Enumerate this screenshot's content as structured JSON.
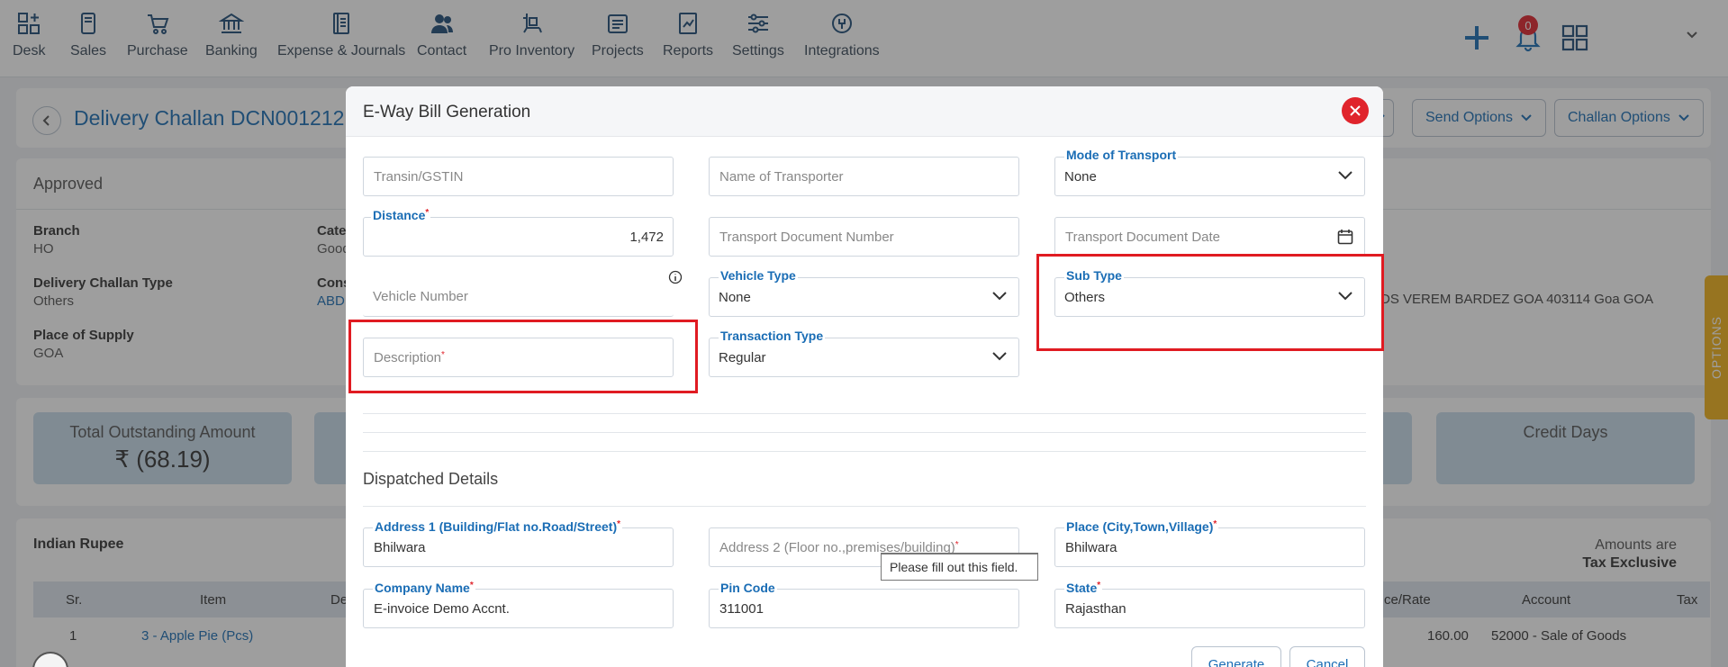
{
  "nav": {
    "items": [
      {
        "label": "Desk",
        "icon": "desk-icon"
      },
      {
        "label": "Sales",
        "icon": "sales-icon"
      },
      {
        "label": "Purchase",
        "icon": "cart-icon"
      },
      {
        "label": "Banking",
        "icon": "bank-icon"
      },
      {
        "label": "Expense & Journals",
        "icon": "journal-icon"
      },
      {
        "label": "Contact",
        "icon": "contact-icon"
      },
      {
        "label": "Pro Inventory",
        "icon": "inventory-icon"
      },
      {
        "label": "Projects",
        "icon": "projects-icon"
      },
      {
        "label": "Reports",
        "icon": "reports-icon"
      },
      {
        "label": "Settings",
        "icon": "settings-icon"
      },
      {
        "label": "Integrations",
        "icon": "integrations-icon"
      }
    ],
    "notification_count": "0"
  },
  "page": {
    "title": "Delivery Challan DCN001212",
    "send_options": "Send Options",
    "challan_options": "Challan Options",
    "status": "Approved",
    "fields": {
      "branch_label": "Branch",
      "branch_value": "HO",
      "category_label": "Cate",
      "category_value": "Good",
      "challan_type_label": "Delivery Challan Type",
      "challan_type_value": "Others",
      "consignee_label": "Cons",
      "consignee_value": "ABD",
      "place_label": "Place of Supply",
      "place_value": "GOA",
      "address_text": "DS VEREM BARDEZ GOA 403114 Goa GOA"
    },
    "options_tab": "OPTIONS",
    "summary": {
      "outstanding_title": "Total Outstanding Amount",
      "outstanding_value": "₹ (68.19)",
      "credit_days_title": "Credit Days"
    },
    "lines": {
      "currency": "Indian Rupee",
      "amounts_are": "Amounts are",
      "tax_mode": "Tax Exclusive",
      "headers": {
        "sr": "Sr.",
        "item": "Item",
        "desc": "De",
        "rate": "ce/Rate",
        "account": "Account",
        "tax": "Tax"
      },
      "row": {
        "sr": "1",
        "item": "3 - Apple Pie (Pcs)",
        "rate": "160.00",
        "account": "52000 - Sale of Goods"
      }
    }
  },
  "modal": {
    "title": "E-Way Bill Generation",
    "fields": {
      "transin_placeholder": "Transin/GSTIN",
      "transporter_placeholder": "Name of Transporter",
      "mode_label": "Mode of Transport",
      "mode_value": "None",
      "distance_label": "Distance",
      "distance_value": "1,472",
      "tdn_placeholder": "Transport Document Number",
      "tdd_placeholder": "Transport Document Date",
      "vehicle_number_placeholder": "Vehicle Number",
      "vehicle_type_label": "Vehicle Type",
      "vehicle_type_value": "None",
      "sub_type_label": "Sub Type",
      "sub_type_value": "Others",
      "description_placeholder": "Description",
      "transaction_type_label": "Transaction Type",
      "transaction_type_value": "Regular"
    },
    "dispatched": {
      "title": "Dispatched Details",
      "address1_label": "Address 1 (Building/Flat no.Road/Street)",
      "address1_value": "Bhilwara",
      "address2_placeholder": "Address 2 (Floor no.,premises/building)",
      "place_label": "Place (City,Town,Village)",
      "place_value": "Bhilwara",
      "company_label": "Company Name",
      "company_value": "E-invoice Demo Accnt.",
      "pin_label": "Pin Code",
      "pin_value": "311001",
      "state_label": "State",
      "state_value": "Rajasthan"
    },
    "tooltip": "Please fill out this field.",
    "generate": "Generate",
    "cancel": "Cancel",
    "required_mark": "*"
  },
  "colors": {
    "accent": "#1a6db5",
    "danger": "#e0242c",
    "highlight": "#e01b22",
    "options_tab": "#f3b21a"
  }
}
